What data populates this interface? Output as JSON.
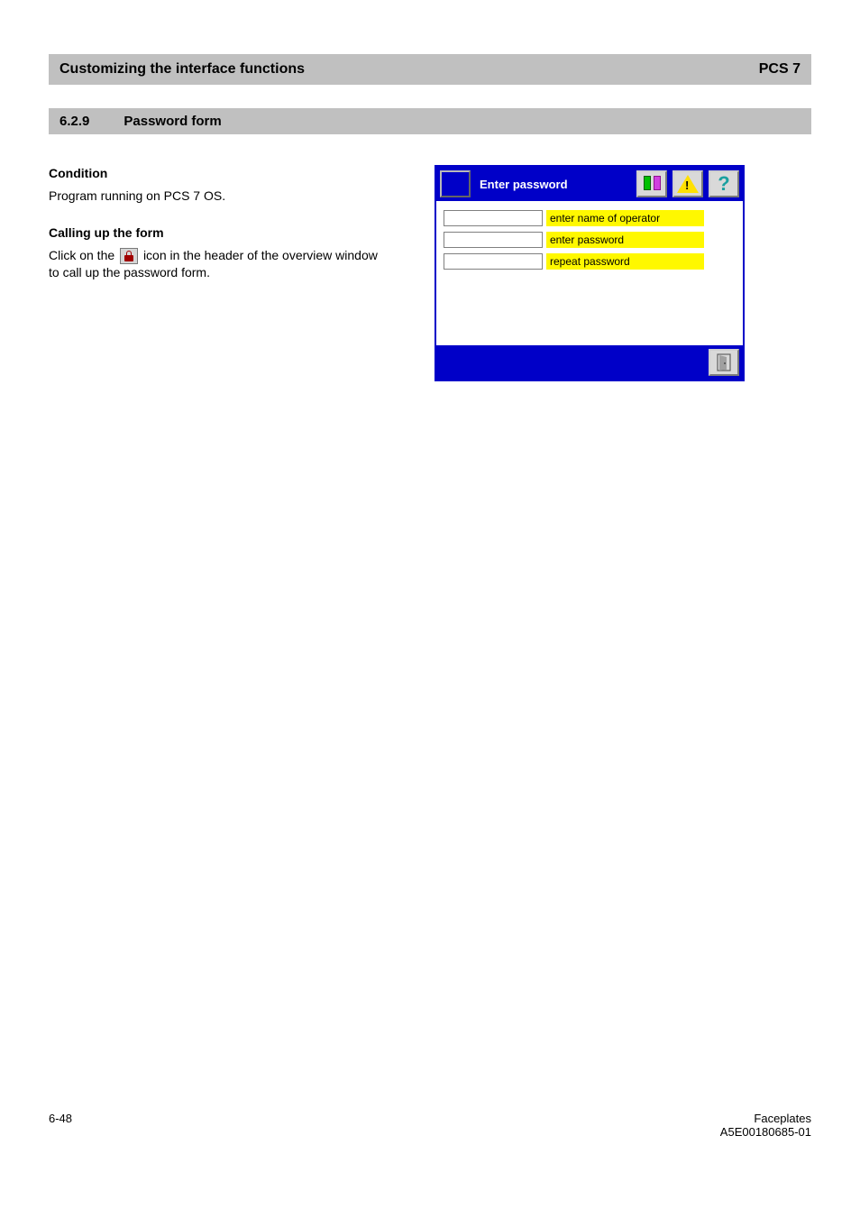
{
  "header": {
    "left": "Customizing the interface functions",
    "right": "PCS 7"
  },
  "section": {
    "number": "6.2.9",
    "title": "Password form"
  },
  "left_text": {
    "condition_head": "Condition",
    "condition_line1": "Program running on PCS 7 OS.",
    "calling_head": "Calling up the form",
    "calling_text_pre": "Click on the ",
    "calling_text_post": " icon in the header of the overview window to call up the password form.",
    "icon_name": "lock-icon"
  },
  "hmi": {
    "title": "Enter password",
    "fields": [
      {
        "value": "",
        "label": "enter name of operator"
      },
      {
        "value": "",
        "label": "enter password"
      },
      {
        "value": "",
        "label": "repeat password"
      }
    ],
    "header_icons": [
      "library-icon",
      "warning-icon",
      "help-icon"
    ],
    "footer_icon": "exit-icon"
  },
  "footer": {
    "page_left": "6-48",
    "page_right": "Faceplates\nA5E00180685-01"
  }
}
